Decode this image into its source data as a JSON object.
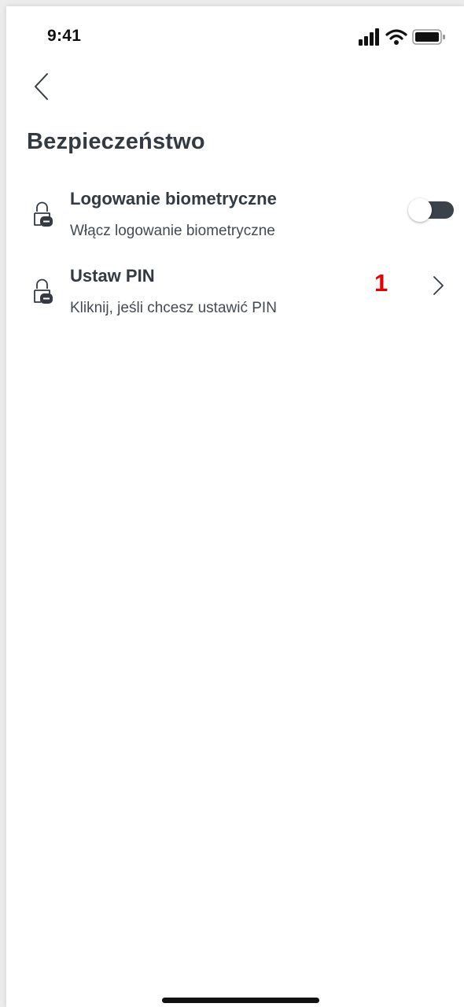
{
  "status_bar": {
    "time": "9:41"
  },
  "header": {
    "back_icon": "chevron-left-icon",
    "title": "Bezpieczeństwo"
  },
  "settings": [
    {
      "icon": "lock-icon",
      "title": "Logowanie biometryczne",
      "subtitle": "Włącz logowanie biometryczne",
      "control": "toggle",
      "toggle_on": false
    },
    {
      "icon": "lock-icon",
      "title": "Ustaw PIN",
      "subtitle": "Kliknij, jeśli chcesz ustawić PIN",
      "control": "chevron",
      "annotation": "1"
    }
  ],
  "colors": {
    "text_primary": "#333a42",
    "toggle_track": "#3c4249",
    "annotation": "#e60000"
  }
}
